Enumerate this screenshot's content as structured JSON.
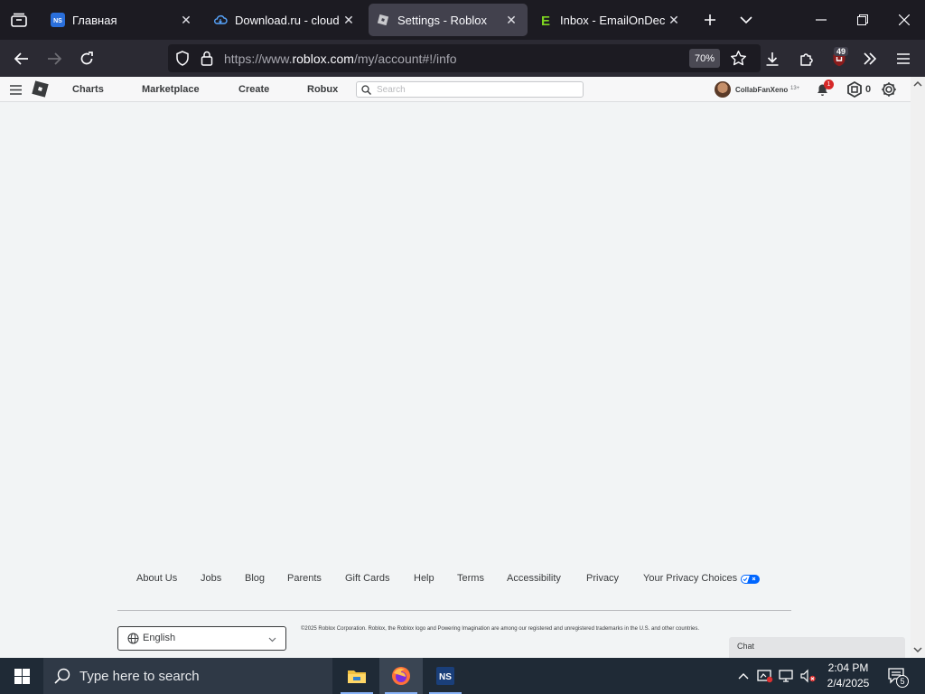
{
  "browser": {
    "tabs": [
      {
        "title": "Главная",
        "favicon": "ns-favicon",
        "active": false
      },
      {
        "title": "Download.ru - cloud st",
        "favicon": "cloud-favicon",
        "active": false
      },
      {
        "title": "Settings - Roblox",
        "favicon": "roblox-favicon",
        "active": true
      },
      {
        "title": "Inbox - EmailOnDeck",
        "favicon": "emailondeck-favicon",
        "active": false
      }
    ],
    "url_prefix": "https://www.",
    "url_domain": "roblox.com",
    "url_path": "/my/account#!/info",
    "zoom": "70%",
    "extension_badge": "49"
  },
  "roblox": {
    "nav": {
      "charts": "Charts",
      "marketplace": "Marketplace",
      "create": "Create",
      "robux": "Robux"
    },
    "search_placeholder": "Search",
    "username": "CollabFanXeno",
    "age_label": "13+",
    "notification_count": "1",
    "robux_balance": "0"
  },
  "footer": {
    "links": {
      "about": "About Us",
      "jobs": "Jobs",
      "blog": "Blog",
      "parents": "Parents",
      "gift_cards": "Gift Cards",
      "help": "Help",
      "terms": "Terms",
      "accessibility": "Accessibility",
      "privacy": "Privacy",
      "privacy_choices": "Your Privacy Choices"
    },
    "language": "English",
    "copyright": "©2025 Roblox Corporation. Roblox, the Roblox logo and Powering Imagination are among our registered and unregistered trademarks in the U.S. and other countries."
  },
  "chat": {
    "label": "Chat"
  },
  "taskbar": {
    "search_placeholder": "Type here to search",
    "time": "2:04 PM",
    "date": "2/4/2025",
    "notification_count": "5"
  },
  "colors": {
    "tabbar_bg": "#1c1b22",
    "navbar_bg": "#2b2a33",
    "page_bg": "#f2f4f5",
    "taskbar_bg": "#1f2a36",
    "notif_red": "#d62828"
  }
}
